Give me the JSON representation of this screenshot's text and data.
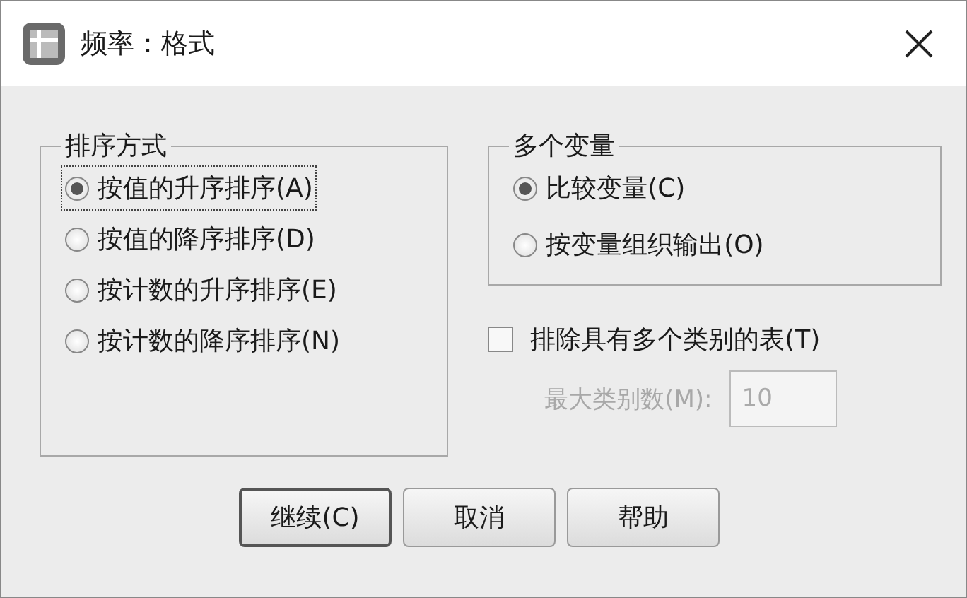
{
  "window": {
    "title": "频率：格式"
  },
  "sort_group": {
    "title": "排序方式",
    "options": [
      {
        "label": "按值的升序排序(A)",
        "selected": true,
        "focused": true
      },
      {
        "label": "按值的降序排序(D)",
        "selected": false,
        "focused": false
      },
      {
        "label": "按计数的升序排序(E)",
        "selected": false,
        "focused": false
      },
      {
        "label": "按计数的降序排序(N)",
        "selected": false,
        "focused": false
      }
    ]
  },
  "multi_group": {
    "title": "多个变量",
    "options": [
      {
        "label": "比较变量(C)",
        "selected": true
      },
      {
        "label": "按变量组织输出(O)",
        "selected": false
      }
    ]
  },
  "exclude": {
    "label": "排除具有多个类别的表(T)",
    "checked": false
  },
  "max_categories": {
    "label": "最大类别数(M):",
    "value": "10",
    "disabled": true
  },
  "buttons": [
    {
      "label": "继续(C)",
      "default": true
    },
    {
      "label": "取消",
      "default": false
    },
    {
      "label": "帮助",
      "default": false
    }
  ]
}
